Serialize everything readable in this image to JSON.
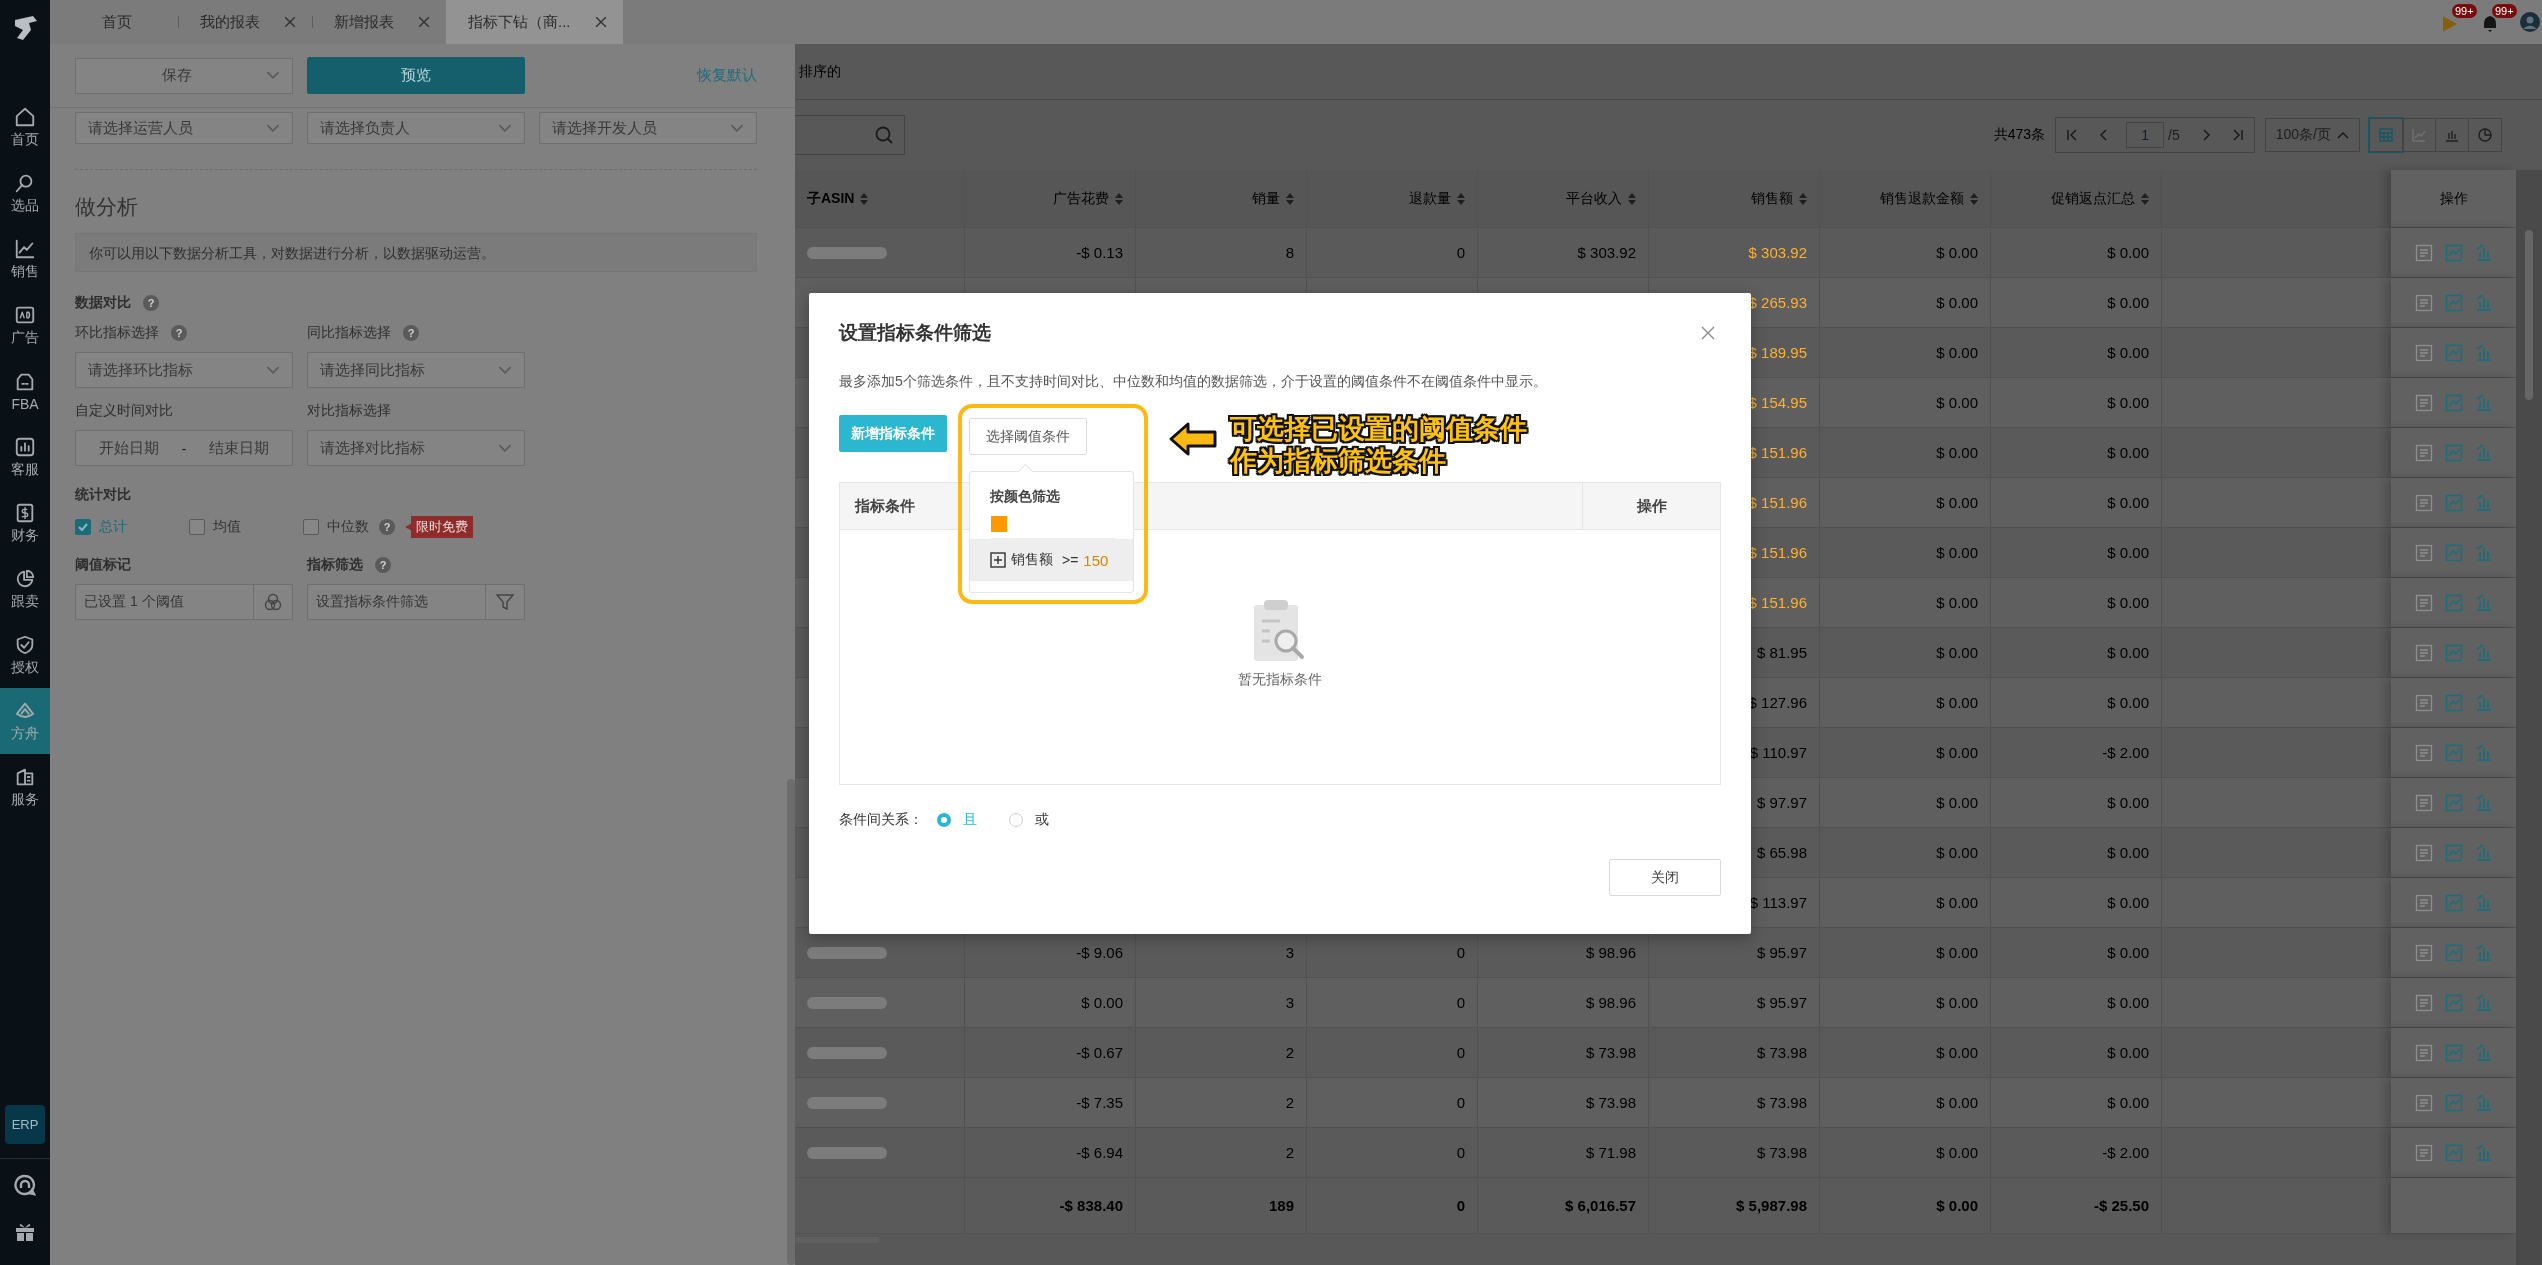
{
  "nav": {
    "items": [
      {
        "label": "首页",
        "selected": false
      },
      {
        "label": "选品",
        "selected": false
      },
      {
        "label": "销售",
        "selected": false
      },
      {
        "label": "广告",
        "selected": false
      },
      {
        "label": "FBA",
        "selected": false
      },
      {
        "label": "客服",
        "selected": false
      },
      {
        "label": "财务",
        "selected": false
      },
      {
        "label": "跟卖",
        "selected": false
      },
      {
        "label": "授权",
        "selected": false
      },
      {
        "label": "方舟",
        "selected": true
      },
      {
        "label": "服务",
        "selected": false
      }
    ],
    "erp": "ERP"
  },
  "tabs": [
    {
      "label": "首页",
      "closable": false,
      "selected": false
    },
    {
      "label": "我的报表",
      "closable": true,
      "selected": false
    },
    {
      "label": "新增报表",
      "closable": true,
      "selected": false
    },
    {
      "label": "指标下钻（商...",
      "closable": true,
      "selected": true
    }
  ],
  "notifications": [
    {
      "kind": "flag",
      "badge": "99+"
    },
    {
      "kind": "bell",
      "badge": "99+"
    }
  ],
  "drawer": {
    "save": "保存",
    "preview": "预览",
    "reset": "恢复默认",
    "people": [
      "请选择运营人员",
      "请选择负责人",
      "请选择开发人员"
    ],
    "section_title": "做分析",
    "info": "你可以用以下数据分析工具，对数据进行分析，以数据驱动运营。",
    "compare": {
      "title": "数据对比",
      "title_help": "?",
      "mom_label": "环比指标选择",
      "mom_help": "?",
      "mom_placeholder": "请选择环比指标",
      "yoy_label": "同比指标选择",
      "yoy_help": "?",
      "yoy_placeholder": "请选择同比指标",
      "custom_label": "自定义时间对比",
      "start_placeholder": "开始日期",
      "separator": "-",
      "end_placeholder": "结束日期",
      "metric_label": "对比指标选择",
      "metric_placeholder": "请选择对比指标"
    },
    "stats": {
      "title": "统计对比",
      "options": [
        {
          "label": "总计",
          "checked": true
        },
        {
          "label": "均值",
          "checked": false
        },
        {
          "label": "中位数",
          "checked": false,
          "help": "?",
          "tag": "限时免费"
        }
      ]
    },
    "threshold": {
      "label": "阈值标记",
      "value": "已设置 1 个阈值"
    },
    "filter": {
      "label": "指标筛选",
      "help": "?",
      "value": "设置指标条件筛选"
    }
  },
  "report": {
    "hint": "排序的",
    "total": "共473条",
    "page": "1",
    "pages": "/5",
    "page_size": "100条/页",
    "views": [
      {
        "kind": "table",
        "selected": true,
        "disabled": false
      },
      {
        "kind": "line",
        "selected": false,
        "disabled": true
      },
      {
        "kind": "bar",
        "selected": false,
        "disabled": false
      },
      {
        "kind": "pie",
        "selected": false,
        "disabled": false
      }
    ],
    "columns": [
      "子ASIN",
      "广告花费",
      "销量",
      "退款量",
      "平台收入",
      "销售额",
      "销售退款金额",
      "促销返点汇总"
    ],
    "action_column": "操作",
    "rows": [
      {
        "asin": {
          "kind": "blurred"
        },
        "ad_spend": "-$ 0.13",
        "units": "8",
        "refund_units": "0",
        "platform_income": "$ 303.92",
        "sales": "$ 303.92",
        "highlight": true,
        "sales_refund": "$ 0.00",
        "promo": "$ 0.00"
      },
      {
        "sales": "$ 265.93",
        "highlight": true,
        "sales_refund": "$ 0.00",
        "promo": "$ 0.00"
      },
      {
        "sales": "$ 189.95",
        "highlight": true,
        "sales_refund": "$ 0.00",
        "promo": "$ 0.00"
      },
      {
        "sales": "$ 154.95",
        "highlight": true,
        "sales_refund": "$ 0.00",
        "promo": "$ 0.00"
      },
      {
        "sales": "$ 151.96",
        "highlight": true,
        "sales_refund": "$ 0.00",
        "promo": "$ 0.00"
      },
      {
        "sales": "$ 151.96",
        "highlight": true,
        "sales_refund": "$ 0.00",
        "promo": "$ 0.00"
      },
      {
        "sales": "$ 151.96",
        "highlight": true,
        "sales_refund": "$ 0.00",
        "promo": "$ 0.00"
      },
      {
        "sales": "$ 151.96",
        "highlight": true,
        "sales_refund": "$ 0.00",
        "promo": "$ 0.00"
      },
      {
        "sales": "$ 81.95",
        "highlight": false,
        "sales_refund": "$ 0.00",
        "promo": "$ 0.00"
      },
      {
        "sales": "$ 127.96",
        "highlight": false,
        "sales_refund": "$ 0.00",
        "promo": "$ 0.00"
      },
      {
        "sales": "$ 110.97",
        "highlight": false,
        "sales_refund": "$ 0.00",
        "promo": "-$ 2.00"
      },
      {
        "sales": "$ 97.97",
        "highlight": false,
        "sales_refund": "$ 0.00",
        "promo": "$ 0.00"
      },
      {
        "sales": "$ 65.98",
        "highlight": false,
        "sales_refund": "$ 0.00",
        "promo": "$ 0.00"
      },
      {
        "sales": "$ 113.97",
        "highlight": false,
        "sales_refund": "$ 0.00",
        "promo": "$ 0.00"
      },
      {
        "asin": {
          "kind": "blurred"
        },
        "ad_spend": "-$ 9.06",
        "units": "3",
        "refund_units": "0",
        "platform_income": "$ 98.96",
        "sales": "$ 95.97",
        "highlight": false,
        "sales_refund": "$ 0.00",
        "promo": "$ 0.00"
      },
      {
        "asin": {
          "kind": "blurred"
        },
        "ad_spend": "$ 0.00",
        "units": "3",
        "refund_units": "0",
        "platform_income": "$ 98.96",
        "sales": "$ 95.97",
        "highlight": false,
        "sales_refund": "$ 0.00",
        "promo": "$ 0.00"
      },
      {
        "asin": {
          "kind": "blurred"
        },
        "ad_spend": "-$ 0.67",
        "units": "2",
        "refund_units": "0",
        "platform_income": "$ 73.98",
        "sales": "$ 73.98",
        "highlight": false,
        "sales_refund": "$ 0.00",
        "promo": "$ 0.00"
      },
      {
        "asin": {
          "kind": "blurred"
        },
        "ad_spend": "-$ 7.35",
        "units": "2",
        "refund_units": "0",
        "platform_income": "$ 73.98",
        "sales": "$ 73.98",
        "highlight": false,
        "sales_refund": "$ 0.00",
        "promo": "$ 0.00"
      },
      {
        "asin": {
          "kind": "blurred"
        },
        "ad_spend": "-$ 6.94",
        "units": "2",
        "refund_units": "0",
        "platform_income": "$ 71.98",
        "sales": "$ 73.98",
        "highlight": false,
        "sales_refund": "$ 0.00",
        "promo": "-$ 2.00"
      }
    ],
    "totals": {
      "ad_spend": "-$ 838.40",
      "units": "189",
      "refund_units": "0",
      "platform_income": "$ 6,016.57",
      "sales": "$ 5,987.98",
      "sales_refund": "$ 0.00",
      "promo": "-$ 25.50"
    }
  },
  "modal": {
    "title": "设置指标条件筛选",
    "note": "最多添加5个筛选条件，且不支持时间对比、中位数和均值的数据筛选，介于设置的阈值条件不在阈值条件中显示。",
    "add": "新增指标条件",
    "pick": "选择阈值条件",
    "popover": {
      "title": "按颜色筛选",
      "swatches": [
        {
          "color": "#ff9900"
        }
      ],
      "items": [
        {
          "metric": "销售额",
          "op": ">=",
          "value": "150",
          "highlighted": true
        }
      ]
    },
    "columns": [
      "指标条件",
      "操作"
    ],
    "empty": "暂无指标条件",
    "relation": {
      "label": "条件间关系：",
      "options": [
        {
          "label": "且",
          "selected": true
        },
        {
          "label": "或",
          "selected": false
        }
      ]
    },
    "close": "关闭"
  },
  "annotation": {
    "lines": [
      "可选择已设置的阈值条件",
      "作为指标筛选条件"
    ]
  }
}
